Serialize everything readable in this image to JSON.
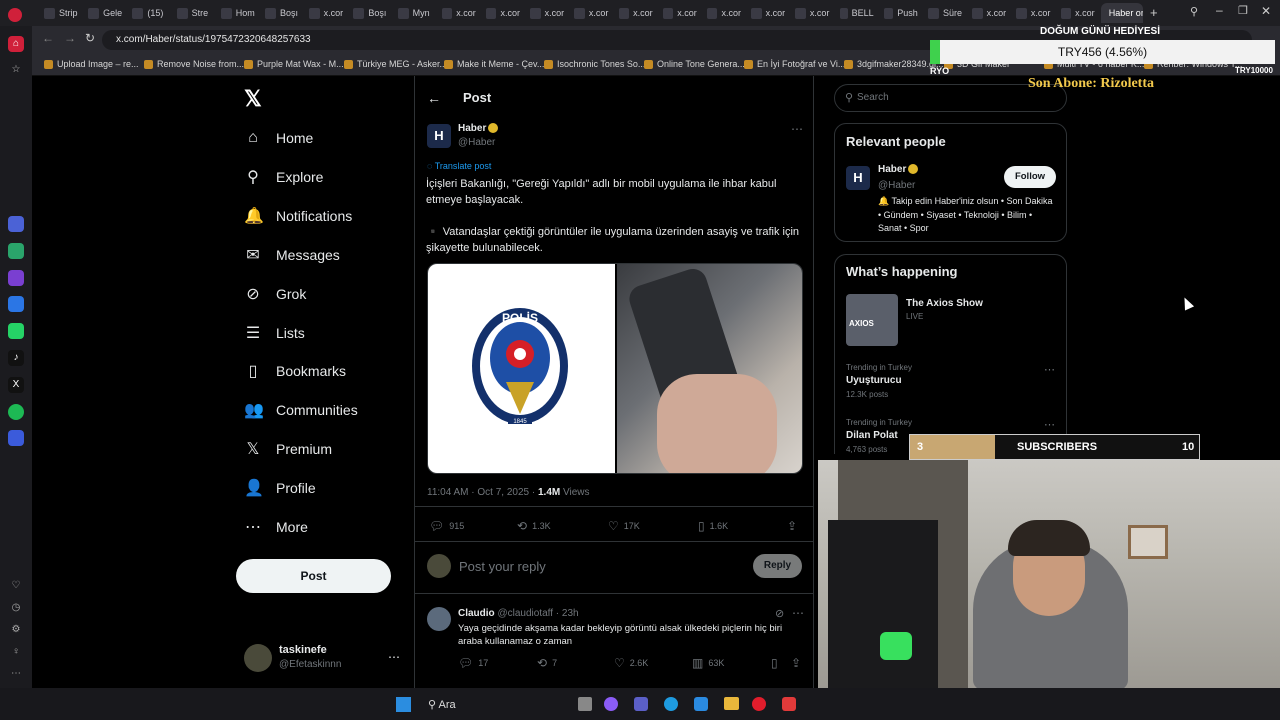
{
  "browser": {
    "tabs": [
      "Strip",
      "Gele",
      "(15)",
      "Stre",
      "Hom",
      "Boşı",
      "x.cor",
      "Boşı",
      "Myn",
      "x.cor",
      "x.cor",
      "x.cor",
      "x.cor",
      "x.cor",
      "x.cor",
      "x.cor",
      "x.cor",
      "x.cor",
      "BELL",
      "Push",
      "Süre",
      "x.cor",
      "x.cor",
      "x.cor",
      "Haber on"
    ],
    "url": "x.com/Haber/status/1975472320648257633",
    "bookmarks": [
      "Upload Image – re...",
      "Remove Noise from...",
      "Purple Mat Wax - M...",
      "Türkiye MEG - Asker...",
      "Make it Meme - Çev...",
      "Isochronic Tones So...",
      "Online Tone Genera...",
      "En İyi Fotoğraf ve Vi...",
      "3dgifmaker28349.gi...",
      "3D Gif Maker",
      "Multi TV - 6 haber K...",
      "Rehber: Windows T..."
    ]
  },
  "nav": {
    "items": [
      {
        "label": "Home",
        "icon": "home-icon",
        "glyph": "⌂"
      },
      {
        "label": "Explore",
        "icon": "search-icon",
        "glyph": "⚲"
      },
      {
        "label": "Notifications",
        "icon": "bell-icon",
        "glyph": "🔔"
      },
      {
        "label": "Messages",
        "icon": "mail-icon",
        "glyph": "✉"
      },
      {
        "label": "Grok",
        "icon": "grok-icon",
        "glyph": "⊘"
      },
      {
        "label": "Lists",
        "icon": "list-icon",
        "glyph": "☰"
      },
      {
        "label": "Bookmarks",
        "icon": "bookmark-icon",
        "glyph": "▯"
      },
      {
        "label": "Communities",
        "icon": "people-icon",
        "glyph": "👥"
      },
      {
        "label": "Premium",
        "icon": "x-logo-icon",
        "glyph": "𝕏"
      },
      {
        "label": "Profile",
        "icon": "person-icon",
        "glyph": "👤"
      },
      {
        "label": "More",
        "icon": "more-icon",
        "glyph": "⋯"
      }
    ],
    "post_label": "Post",
    "account": {
      "name": "taskinefe",
      "handle": "@Efetaskinnn"
    }
  },
  "post": {
    "header": "Post",
    "author": "Haber",
    "handle": "@Haber",
    "translate": "Translate post",
    "text1": "İçişleri Bakanlığı, \"Gereği Yapıldı\" adlı bir mobil uygulama ile ihbar kabul etmeye başlayacak.",
    "text2": "▪️ Vatandaşlar çektiği görüntüler ile uygulama üzerinden asayiş ve trafik için şikayette bulunabilecek.",
    "badge_text": "POLİS",
    "badge_ring": "EMNİYET GENEL MÜDÜRLÜĞÜ",
    "badge_year": "1845",
    "time": "11:04 AM · Oct 7, 2025 · ",
    "views": "1.4M",
    "views_label": "Views",
    "stats": {
      "replies": "915",
      "reposts": "1.3K",
      "likes": "17K",
      "bookmarks": "1.6K"
    },
    "reply_placeholder": "Post your reply",
    "reply_button": "Reply"
  },
  "reply": {
    "author": "Claudio",
    "handle": "@claudiotaff · 23h",
    "text": "Yaya geçidinde akşama kadar bekleyip görüntü alsak ülkedeki piçlerin hiç biri araba kullanamaz o zaman",
    "stats": {
      "replies": "17",
      "reposts": "7",
      "likes": "2.6K",
      "views": "63K"
    }
  },
  "sidebar": {
    "search_placeholder": "Search",
    "relevant_title": "Relevant people",
    "person": {
      "name": "Haber",
      "handle": "@Haber",
      "follow": "Follow",
      "bio": "🔔 Takip edin Haber'iniz olsun • Son Dakika • Gündem • Siyaset • Teknoloji • Bilim • Sanat • Spor"
    },
    "happening_title": "What’s happening",
    "live": {
      "title": "The Axios Show",
      "status": "LIVE",
      "thumb": "AXIOS"
    },
    "trends": [
      {
        "context": "Trending in Turkey",
        "name": "Uyuşturucu",
        "posts": "12.3K posts"
      },
      {
        "context": "Trending in Turkey",
        "name": "Dilan Polat",
        "posts": "4,763 posts"
      }
    ]
  },
  "overlay": {
    "birthday": "DOĞUM GÜNÜ HEDİYESİ",
    "goal": "TRY456 (4.56%)",
    "left": "RYO",
    "right": "TRY10000",
    "last_sub": "Son Abone: Rizoletta",
    "subs_current": "3",
    "subs_label": "SUBSCRIBERS",
    "subs_target": "10"
  },
  "taskbar": {
    "search": "Ara"
  },
  "colors": {
    "accent": "#1d9bf0",
    "verified": "#e0b82b",
    "bg": "#000000",
    "muted": "#71767b"
  }
}
